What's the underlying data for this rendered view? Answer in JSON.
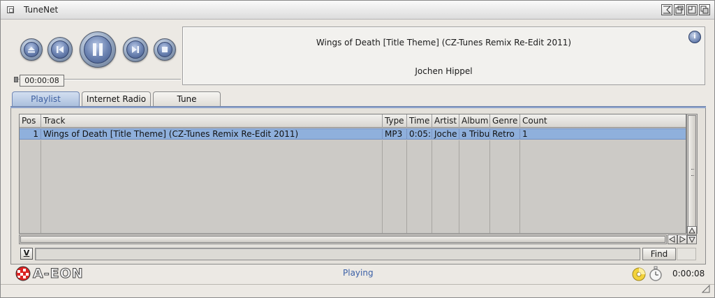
{
  "window": {
    "title": "TuneNet"
  },
  "transport": {
    "buttons": [
      "eject",
      "previous",
      "pause",
      "next",
      "stop"
    ],
    "elapsed": "00:00:08",
    "seek_progress": 0.0
  },
  "now_playing": {
    "title": "Wings of Death [Title Theme] (CZ-Tunes Remix Re-Edit 2011)",
    "artist": "Jochen Hippel"
  },
  "tabs": [
    {
      "label": "Playlist",
      "active": true
    },
    {
      "label": "Internet Radio",
      "active": false
    },
    {
      "label": "Tune",
      "active": false
    }
  ],
  "playlist": {
    "columns": [
      "Pos",
      "Track",
      "Type",
      "Time",
      "Artist",
      "Album",
      "Genre",
      "Count"
    ],
    "rows": [
      {
        "pos": "1",
        "track": "Wings of Death [Title Theme] (CZ-Tunes Remix Re-Edit 2011)",
        "type": "MP3",
        "time": "0:05:",
        "artist": "Joche",
        "album": "a Tribu",
        "genre": "Retro",
        "count": "1",
        "selected": true
      }
    ]
  },
  "find": {
    "toggle_label": "V",
    "value": "",
    "button_label": "Find"
  },
  "status": {
    "logo_text": "A-EON",
    "state": "Playing",
    "time": "0:00:08"
  },
  "colors": {
    "accent": "#8fb0dc",
    "status_text": "#3a5fa6",
    "button_blue": "#5d6f8c"
  }
}
